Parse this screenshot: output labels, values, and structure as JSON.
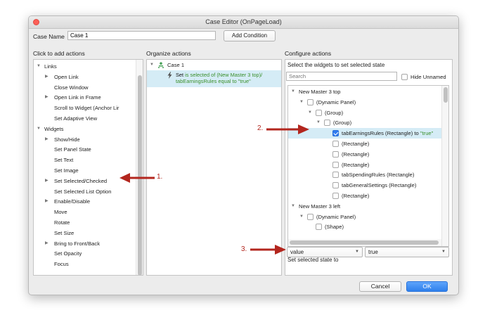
{
  "window": {
    "title": "Case Editor (OnPageLoad)"
  },
  "case": {
    "label": "Case Name",
    "value": "Case 1",
    "add_condition": "Add Condition"
  },
  "left_panel": {
    "header": "Click to add actions",
    "items": [
      {
        "label": "Links",
        "tri": "▼"
      },
      {
        "label": "Open Link",
        "tri": "▶"
      },
      {
        "label": "Close Window",
        "tri": ""
      },
      {
        "label": "Open Link in Frame",
        "tri": "▶"
      },
      {
        "label": "Scroll to Widget (Anchor Lir",
        "tri": ""
      },
      {
        "label": "Set Adaptive View",
        "tri": ""
      },
      {
        "label": "Widgets",
        "tri": "▼"
      },
      {
        "label": "Show/Hide",
        "tri": "▶"
      },
      {
        "label": "Set Panel State",
        "tri": ""
      },
      {
        "label": "Set Text",
        "tri": ""
      },
      {
        "label": "Set Image",
        "tri": ""
      },
      {
        "label": "Set Selected/Checked",
        "tri": "▶"
      },
      {
        "label": "Set Selected List Option",
        "tri": ""
      },
      {
        "label": "Enable/Disable",
        "tri": "▶"
      },
      {
        "label": "Move",
        "tri": ""
      },
      {
        "label": "Rotate",
        "tri": ""
      },
      {
        "label": "Set Size",
        "tri": ""
      },
      {
        "label": "Bring to Front/Back",
        "tri": "▶"
      },
      {
        "label": "Set Opacity",
        "tri": ""
      },
      {
        "label": "Focus",
        "tri": ""
      }
    ]
  },
  "middle_panel": {
    "header": "Organize actions",
    "case_label": "Case 1",
    "tri": "▼",
    "action_verb": "Set",
    "action_line1": " is selected of (New Master 3 top)/",
    "action_line2": "tabEarningsRules equal to \"true\""
  },
  "right_panel": {
    "header": "Configure actions",
    "subheader": "Select the widgets to set selected state",
    "search_placeholder": "Search",
    "hide_unnamed": "Hide Unnamed",
    "tree": [
      {
        "label": "New Master 3 top",
        "tri": "▼",
        "checkbox": false,
        "checked": false
      },
      {
        "label": "(Dynamic Panel)",
        "tri": "▼",
        "checkbox": true,
        "checked": false
      },
      {
        "label": "(Group)",
        "tri": "▼",
        "checkbox": true,
        "checked": false
      },
      {
        "label": "(Group)",
        "tri": "▼",
        "checkbox": true,
        "checked": false
      },
      {
        "label": "tabEarningsRules (Rectangle) to ",
        "suffix": "\"true\"",
        "tri": "",
        "checkbox": true,
        "checked": true
      },
      {
        "label": "(Rectangle)",
        "tri": "",
        "checkbox": true,
        "checked": false
      },
      {
        "label": "(Rectangle)",
        "tri": "",
        "checkbox": true,
        "checked": false
      },
      {
        "label": "(Rectangle)",
        "tri": "",
        "checkbox": true,
        "checked": false
      },
      {
        "label": "tabSpendingRules (Rectangle)",
        "tri": "",
        "checkbox": true,
        "checked": false
      },
      {
        "label": "tabGeneralSettings (Rectangle)",
        "tri": "",
        "checkbox": true,
        "checked": false
      },
      {
        "label": "(Rectangle)",
        "tri": "",
        "checkbox": true,
        "checked": false
      },
      {
        "label": "New Master 3 left",
        "tri": "▼",
        "checkbox": false,
        "checked": false
      },
      {
        "label": "(Dynamic Panel)",
        "tri": "▼",
        "checkbox": true,
        "checked": false
      },
      {
        "label": "(Shape)",
        "tri": "",
        "checkbox": true,
        "checked": false
      }
    ],
    "state_label": "Set selected state to",
    "state_select": "value",
    "value_select": "true"
  },
  "footer": {
    "cancel": "Cancel",
    "ok": "OK"
  },
  "annotations": {
    "a1": "1.",
    "a2": "2.",
    "a3": "3."
  },
  "colors": {
    "accent": "#2f80ec",
    "annotation": "#b3261e",
    "selection": "#d5ecf6",
    "action_text": "#3a8f2a"
  }
}
